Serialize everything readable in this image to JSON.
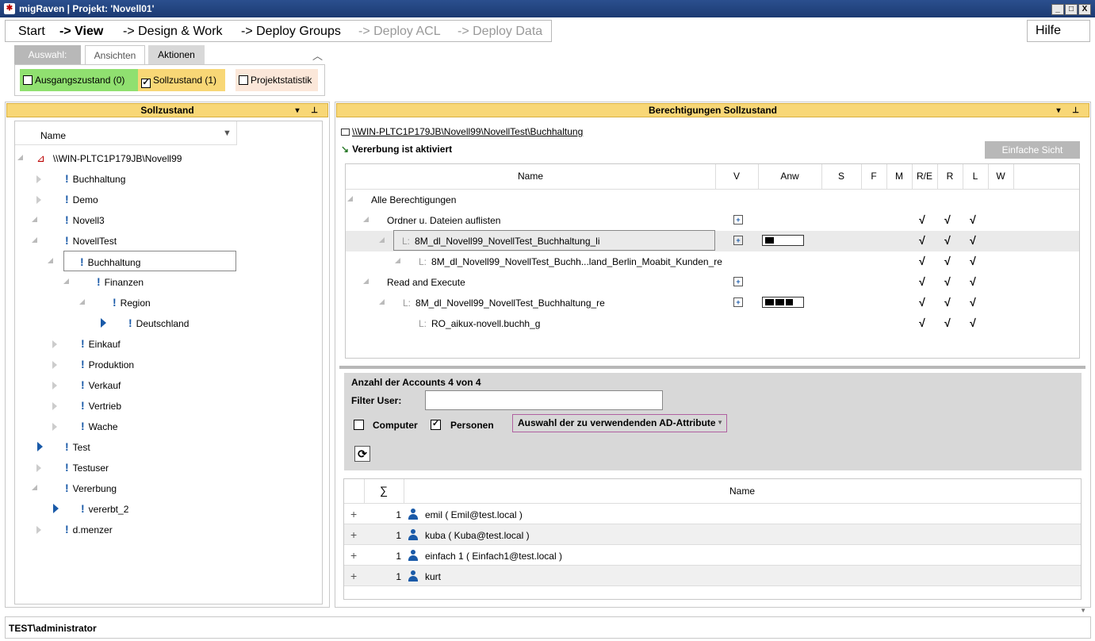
{
  "window": {
    "title": "migRaven | Projekt: 'Novell01'",
    "controls": [
      "_",
      "□",
      "X"
    ]
  },
  "menu": {
    "items": [
      "Start",
      "-> View",
      "-> Design & Work",
      "-> Deploy Groups",
      "-> Deploy ACL",
      "-> Deploy Data"
    ],
    "help": "Hilfe"
  },
  "ribbon": {
    "tabs": [
      "Auswahl:",
      "Ansichten",
      "Aktionen"
    ],
    "buttons": [
      "Ausgangszustand (0)",
      "Sollzustand (1)",
      "Projektstatistik"
    ],
    "sollzustand_checked": true,
    "colors": {
      "ausgang": "#90e070",
      "soll": "#f8d776",
      "statistik": "#fbe7d9"
    }
  },
  "left_panel": {
    "title": "Sollzustand",
    "column_name": "Name",
    "root": "\\\\WIN-PLTC1P179JB\\Novell99",
    "nodes": [
      "Buchhaltung",
      "Demo",
      "Novell3",
      "NovellTest",
      "Buchhaltung",
      "Finanzen",
      "Region",
      "Deutschland",
      "Einkauf",
      "Produktion",
      "Verkauf",
      "Vertrieb",
      "Wache",
      "Test",
      "Testuser",
      "Vererbung",
      "vererbt_2",
      "d.menzer"
    ]
  },
  "right_panel": {
    "title": "Berechtigungen Sollzustand",
    "path": "\\\\WIN-PLTC1P179JB\\Novell99\\NovellTest\\Buchhaltung",
    "inheritance": "Vererbung ist aktiviert",
    "simple_view_button": "Einfache Sicht",
    "columns": [
      "Name",
      "V",
      "Anw",
      "S",
      "F",
      "M",
      "R/E",
      "R",
      "L",
      "W"
    ],
    "rows": [
      "Alle Berechtigungen",
      "Ordner u. Dateien auflisten",
      "8M_dl_Novell99_NovellTest_Buchhaltung_li",
      "8M_dl_Novell99_NovellTest_Buchh...land_Berlin_Moabit_Kunden_re",
      "Read and Execute",
      "8M_dl_Novell99_NovellTest_Buchhaltung_re",
      "RO_aikux-novell.buchh_g"
    ],
    "check_mark": "√"
  },
  "accounts": {
    "count_text": "Anzahl der Accounts 4 von 4",
    "filter_label": "Filter User:",
    "filter_value": "",
    "computer_label": "Computer",
    "computer_checked": false,
    "personen_label": "Personen",
    "personen_checked": true,
    "ad_select": "Auswahl der zu verwendenden AD-Attribute",
    "grid_columns": [
      "∑",
      "Name"
    ],
    "users": [
      {
        "count": "1",
        "name": "emil ( Emil@test.local )"
      },
      {
        "count": "1",
        "name": "kuba ( Kuba@test.local )"
      },
      {
        "count": "1",
        "name": "einfach 1 ( Einfach1@test.local )"
      },
      {
        "count": "1",
        "name": "kurt"
      }
    ]
  },
  "status": {
    "user": "TEST\\administrator"
  }
}
